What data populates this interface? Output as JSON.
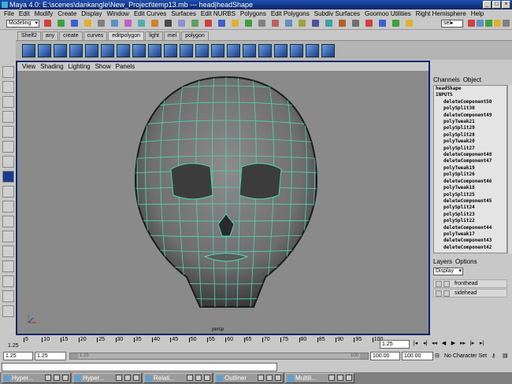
{
  "window": {
    "title": "Maya 4.0: E:\\scenes\\dankangle\\New_Project\\temp13.mb  ---  head|headShape"
  },
  "menu": [
    "File",
    "Edit",
    "Modify",
    "Create",
    "Display",
    "Window",
    "Edit Curves",
    "Surfaces",
    "Edit NURBS",
    "Polygons",
    "Edit Polygons",
    "Subdiv Surfaces",
    "Goomoo Utilities",
    "Right Hemisphere",
    "Help"
  ],
  "statusline": {
    "mode": "Modeling",
    "sel_label": "sel▸"
  },
  "shelf": {
    "tabs": [
      "Shelf2",
      "any",
      "create",
      "curves",
      "editpolygon",
      "light",
      "mel",
      "polygon"
    ],
    "active": "editpolygon"
  },
  "viewport": {
    "menu": [
      "View",
      "Shading",
      "Lighting",
      "Show",
      "Panels"
    ],
    "camera_label": "persp"
  },
  "channelbox": {
    "tabs": [
      "Channels",
      "Object"
    ],
    "object_name": "headShape",
    "inputs_header": "INPUTS",
    "nodes": [
      "deleteComponent50",
      "polySplit30",
      "deleteComponent49",
      "polyTweak21",
      "polySplit29",
      "polySplit28",
      "polyTweak20",
      "polySplit27",
      "deleteComponent48",
      "deleteComponent47",
      "polyTweak19",
      "polySplit26",
      "deleteComponent46",
      "polyTweak18",
      "polySplit25",
      "deleteComponent45",
      "polySplit24",
      "polySplit23",
      "polySplit22",
      "deleteComponent44",
      "polyTweak17",
      "deleteComponent43",
      "deleteComponent42"
    ]
  },
  "layers": {
    "tabs": [
      "Layers",
      "Options"
    ],
    "display": "Display",
    "items": [
      "fronthead",
      "sidehead"
    ]
  },
  "timeslider": {
    "ticks": [
      "5",
      "10",
      "15",
      "20",
      "25",
      "30",
      "35",
      "40",
      "45",
      "50",
      "55",
      "60",
      "65",
      "70",
      "75",
      "80",
      "85",
      "90",
      "95",
      "100"
    ],
    "start_marker": "1.25",
    "current_time": "1.25"
  },
  "range": {
    "start": "1.25",
    "start2": "1.25",
    "end": "100.00",
    "end2": "100.00",
    "left_hint": "1.25",
    "right_hint": "100",
    "character_set": "No Character Set"
  },
  "taskbar": [
    "Hyper...",
    "Hyper...",
    "Relati...",
    "Outliner",
    "Multili..."
  ]
}
